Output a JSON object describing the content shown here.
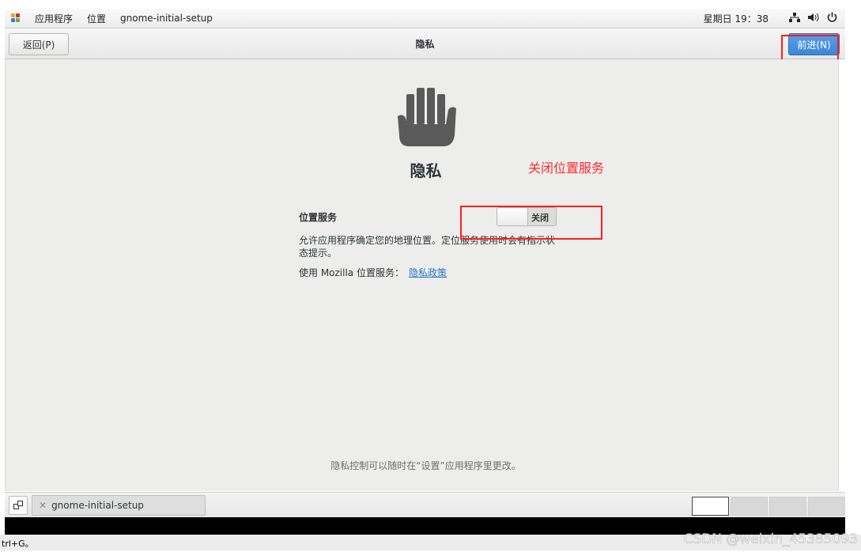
{
  "topbar": {
    "menu": [
      "应用程序",
      "位置",
      "gnome-initial-setup"
    ],
    "clock": "星期日 19：38",
    "tray_icons": [
      "network-icon",
      "volume-icon",
      "power-icon"
    ]
  },
  "headerbar": {
    "back_label": "返回(P)",
    "title": "隐私",
    "next_label": "前进(N)"
  },
  "content": {
    "icon": "hand-icon",
    "title": "隐私",
    "annotation": "关闭位置服务",
    "location_label": "位置服务",
    "switch_state": "关闭",
    "description": "允许应用程序确定您的地理位置。定位服务使用时会有指示状态提示。",
    "mozilla_text": "使用 Mozilla 位置服务：",
    "policy_link": "隐私政策",
    "footer_note": "隐私控制可以随时在“设置”应用程序里更改。"
  },
  "taskbar": {
    "task_label": "gnome-initial-setup"
  },
  "status": {
    "shortcut_text": "trl+G。",
    "watermark": "CSDN @weixin_45385093"
  },
  "colors": {
    "accent": "#3e86d6",
    "annotation": "#ff1d1d"
  }
}
